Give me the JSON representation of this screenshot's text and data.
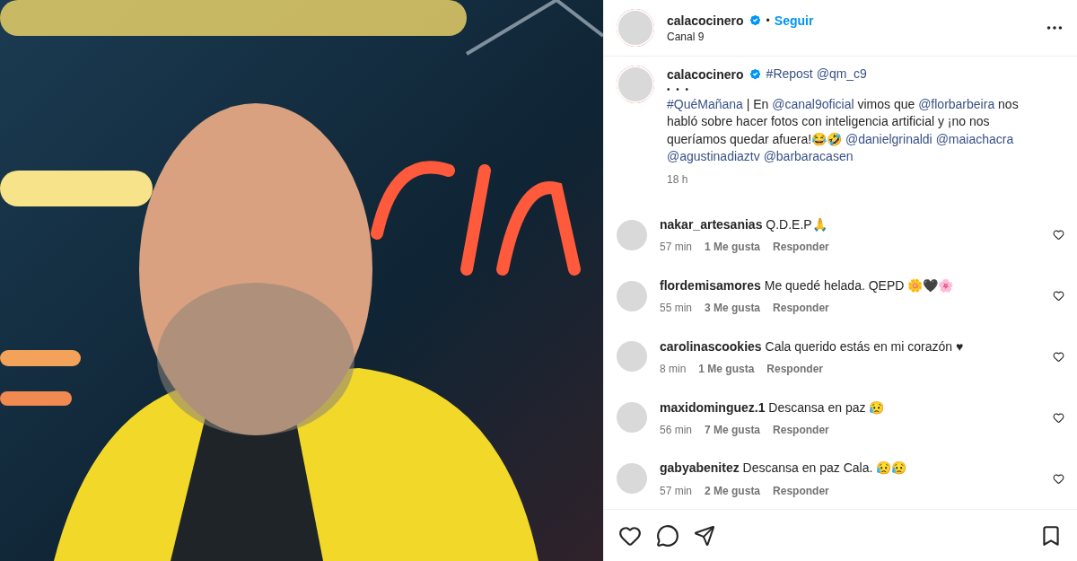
{
  "header": {
    "username": "calacocinero",
    "verified": true,
    "separator": "•",
    "follow": "Seguir",
    "subtitle": "Canal 9"
  },
  "caption": {
    "username": "calacocinero",
    "verified": true,
    "first_line": [
      {
        "kind": "link",
        "text": "#Repost"
      },
      {
        "kind": "link",
        "text": "@qm_c9"
      }
    ],
    "dots": "•  •  •",
    "body": [
      {
        "kind": "link",
        "text": "#QuéMañana"
      },
      {
        "kind": "text",
        "text": " | En "
      },
      {
        "kind": "link",
        "text": "@canal9oficial"
      },
      {
        "kind": "text",
        "text": " vimos que "
      },
      {
        "kind": "link",
        "text": "@florbarbeira"
      },
      {
        "kind": "text",
        "text": " nos habló sobre hacer fotos con inteligencia artificial y ¡no nos queríamos quedar afuera!😂🤣 "
      },
      {
        "kind": "link",
        "text": "@danielgrinaldi"
      },
      {
        "kind": "link",
        "text": "@maiachacra"
      },
      {
        "kind": "link",
        "text": "@agustinadiaztv"
      },
      {
        "kind": "link",
        "text": "@barbaracasen"
      }
    ],
    "time": "18 h"
  },
  "comments": [
    {
      "username": "nakar_artesanias",
      "text": "Q.D.E.P🙏",
      "time": "57 min",
      "likes": "1 Me gusta",
      "reply": "Responder",
      "liked": false
    },
    {
      "username": "flordemisamores",
      "text": "Me quedé helada. QEPD 🌼🖤🌸",
      "time": "55 min",
      "likes": "3 Me gusta",
      "reply": "Responder",
      "liked": false
    },
    {
      "username": "carolinascookies",
      "text": "Cala querido estás en mi corazón ♥",
      "time": "8 min",
      "likes": "1 Me gusta",
      "reply": "Responder",
      "liked": false
    },
    {
      "username": "maxidominguez.1",
      "text": "Descansa en paz 😥",
      "time": "56 min",
      "likes": "7 Me gusta",
      "reply": "Responder",
      "liked": false
    },
    {
      "username": "gabyabenitez",
      "text": "Descansa en paz Cala. 😥😥",
      "time": "57 min",
      "likes": "2 Me gusta",
      "reply": "Responder",
      "liked": false
    }
  ],
  "actions": {
    "liked": false,
    "saved": false
  }
}
